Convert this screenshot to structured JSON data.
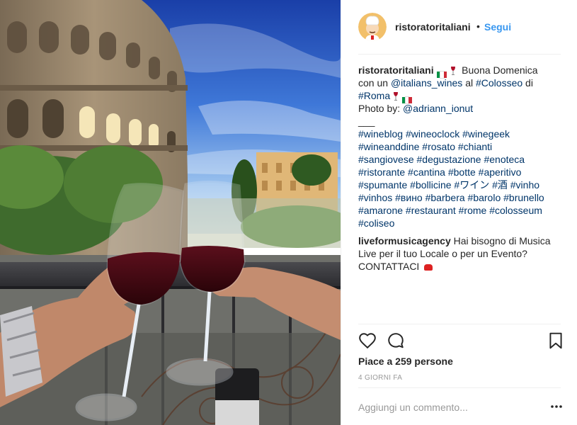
{
  "post": {
    "author": "ristoratoritaliani",
    "dot": "•",
    "follow_label": "Segui"
  },
  "caption": {
    "username": "ristoratoritaliani",
    "text_1": "Buona Domenica",
    "text_2": "con un",
    "mention": "@italians_wines",
    "text_3": "al",
    "tag_colosseo": "#Colosseo",
    "text_4": "di",
    "tag_roma": "#Roma",
    "photo_by": "Photo by:",
    "photo_mention": "@adriann_ionut",
    "divider": "___",
    "hashtag_lines": [
      "#wineblog #wineoclock #winegeek",
      "#wineanddine #rosato #chianti",
      "#sangiovese #degustazione #enoteca",
      "#ristorante #cantina #botte #aperitivo",
      "#spumante #bollicine #ワイン #酒 #vinho",
      "#vinhos #вино #barbera #barolo #brunello",
      "#amarone #restaurant #rome #colosseum",
      "#coliseo"
    ]
  },
  "comment": {
    "username": "liveformusicagency",
    "text_line_1": "Hai bisogno di Musica",
    "text_line_2": "Live per il tuo Locale o per un Evento?",
    "text_line_3": "CONTATTACI"
  },
  "likes_text": "Piace a 259 persone",
  "time_text": "4 GIORNI FA",
  "comment_box": {
    "placeholder": "Aggiungi un commento..."
  },
  "icons": {
    "like": "heart-icon",
    "comment": "comment-icon",
    "save": "bookmark-icon",
    "more": "more-options-icon"
  },
  "colors": {
    "link": "#003569",
    "follow": "#3897f0",
    "muted": "#999999",
    "text": "#262626"
  }
}
